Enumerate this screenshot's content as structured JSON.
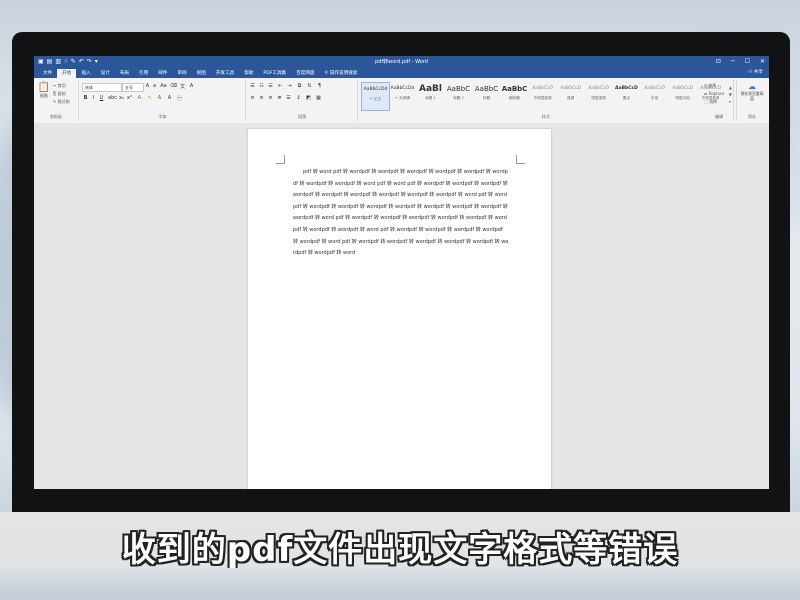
{
  "window": {
    "title": "pdf转word.pdf - Word",
    "controls": [
      "⊡",
      "─",
      "☐",
      "✕"
    ]
  },
  "qat": {
    "icons": [
      "save-icon",
      "new-doc-icon",
      "open-icon",
      "touch-mode-icon",
      "format-painter-icon",
      "undo-icon",
      "redo-icon",
      "customize-icon"
    ]
  },
  "menu": {
    "tabs": [
      "文件",
      "开始",
      "插入",
      "设计",
      "布局",
      "引用",
      "邮件",
      "审阅",
      "视图",
      "开发工具",
      "帮助",
      "PDF工具集",
      "百度网盘"
    ],
    "active_tab": "开始",
    "tell_me": "操作说明搜索",
    "share": "共享"
  },
  "ribbon": {
    "clipboard": {
      "paste": "粘贴",
      "cut": "剪切",
      "copy": "复制",
      "format_painter": "格式刷",
      "label": "剪贴板"
    },
    "font": {
      "font_name": "宋体",
      "font_size": "五号",
      "label": "字体"
    },
    "paragraph": {
      "label": "段落"
    },
    "styles": {
      "label": "样式",
      "items": [
        {
          "preview": "AaBbCcDd",
          "name": "↵ 正文"
        },
        {
          "preview": "AaBbCcDd",
          "name": "↵ 无间隔"
        },
        {
          "preview": "AaBl",
          "name": "标题 1"
        },
        {
          "preview": "AaBbC",
          "name": "标题 2"
        },
        {
          "preview": "AaBbC",
          "name": "标题"
        },
        {
          "preview": "AaBbC",
          "name": "副标题"
        },
        {
          "preview": "AaBbCcD",
          "name": "不明显强调"
        },
        {
          "preview": "AaBbCcD",
          "name": "强调"
        },
        {
          "preview": "AaBbCcD",
          "name": "明显强调"
        },
        {
          "preview": "AaBbCcD",
          "name": "要点"
        },
        {
          "preview": "AaBbCcD",
          "name": "引用"
        },
        {
          "preview": "AaBbCcD",
          "name": "明显引用"
        },
        {
          "preview": "AaBbCcD",
          "name": "不明显参考"
        }
      ]
    },
    "editing": {
      "find": "查找",
      "replace": "Replace",
      "select": "选择",
      "label": "编辑"
    },
    "save": {
      "button": "保存到百度网盘",
      "label": "保存"
    }
  },
  "document": {
    "text": "pdf 转 word pdf 转 wordpdf 转 wordpdf 转 wordpdf 转 wordpdf 转 wordpdf 转 wordpdf 转 wordpdf 转 wordpdf 转 word pdf 转 word pdf 转 wordpdf 转 wordpdf 转 wordpdf 转 wordpdf 转 wordpdf 转 wordpdf 转 wordpdf 转 wordpdf 转 wordpdf 转 word pdf 转 wordpdf 转 wordpdf 转 wordpdf 转 wordpdf 转 wordpdf 转 wordpdf 转 wordpdf 转 wordpdf 转 wordpdf 转 word pdf 转 wordpdf 转 wordpdf 转 wordpdf 转 wordpdf 转 wordpdf 转 wordpdf 转 wordpdf 转 wordpdf 转 word pdf 转 wordpdf 转 wordpdf 转 wordpdf 转 wordpdf 转 wordpdf 转 word pdf 转 wordpdf 转 wordpdf 转 wordpdf 转 wordpdf 转 wordpdf 转 wordpdf 转 wordpdf 转 word"
  },
  "caption": "收到的pdf文件出现文字格式等错误",
  "colors": {
    "accent": "#2b579a",
    "ribbon": "#f3f3f3",
    "workspace": "#e6e6e6"
  }
}
